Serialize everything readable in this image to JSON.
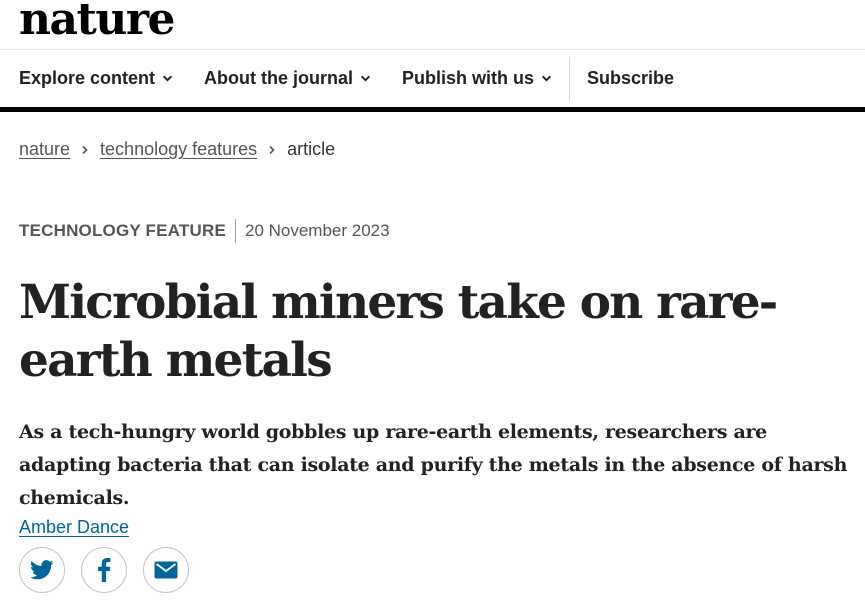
{
  "site": {
    "logo": "nature"
  },
  "nav": {
    "items": [
      {
        "label": "Explore content"
      },
      {
        "label": "About the journal"
      },
      {
        "label": "Publish with us"
      }
    ],
    "subscribe": "Subscribe"
  },
  "breadcrumb": {
    "items": [
      "nature",
      "technology features",
      "article"
    ]
  },
  "article": {
    "type": "TECHNOLOGY FEATURE",
    "date": "20 November 2023",
    "title": "Microbial miners take on rare-earth metals",
    "standfirst": "As a tech-hungry world gobbles up rare-earth elements, researchers are adapting bacteria that can isolate and purify the metals in the absence of harsh chemicals.",
    "author": "Amber Dance"
  },
  "share": {
    "icons": [
      "twitter-icon",
      "facebook-icon",
      "email-icon"
    ],
    "brand_color": "#006699"
  }
}
